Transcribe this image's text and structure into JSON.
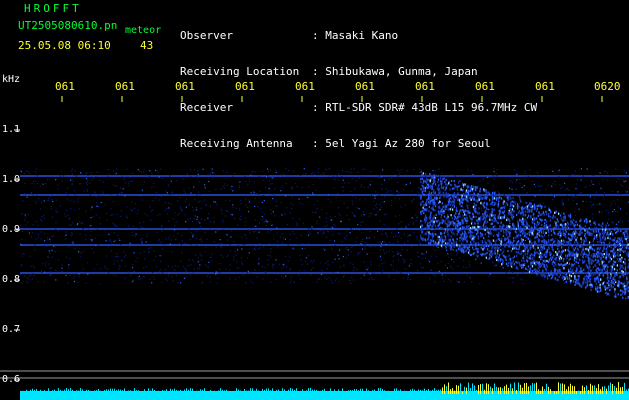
{
  "header": {
    "brand": "HROFFT",
    "file_name": "UT2505080610.pn",
    "mode": "meteor",
    "datetime": "25.05.08 06:10",
    "count": "43",
    "rows": [
      {
        "label": "Observer",
        "value": ": Masaki Kano"
      },
      {
        "label": "Receiving Location",
        "value": ": Shibukawa, Gunma, Japan"
      },
      {
        "label": "Receiver",
        "value": ": RTL-SDR SDR# 43dB L15 96.7MHz CW"
      },
      {
        "label": "Receiving Antenna",
        "value": ": 5el Yagi Az 280 for Seoul"
      }
    ]
  },
  "axes": {
    "y_unit": "kHz",
    "y_ticks": [
      "1.1",
      "1.0",
      "0.9",
      "0.8",
      "0.7",
      "0.6"
    ],
    "x_ticks": [
      "061",
      "061",
      "061",
      "061",
      "061",
      "061",
      "061",
      "061",
      "061",
      "0620"
    ]
  },
  "colors": {
    "background": "#000000",
    "noise": "#0a1a6e",
    "signal": "#2f5fff",
    "baseline": "#00e5ff",
    "baseline_peak": "#ffff33"
  }
}
